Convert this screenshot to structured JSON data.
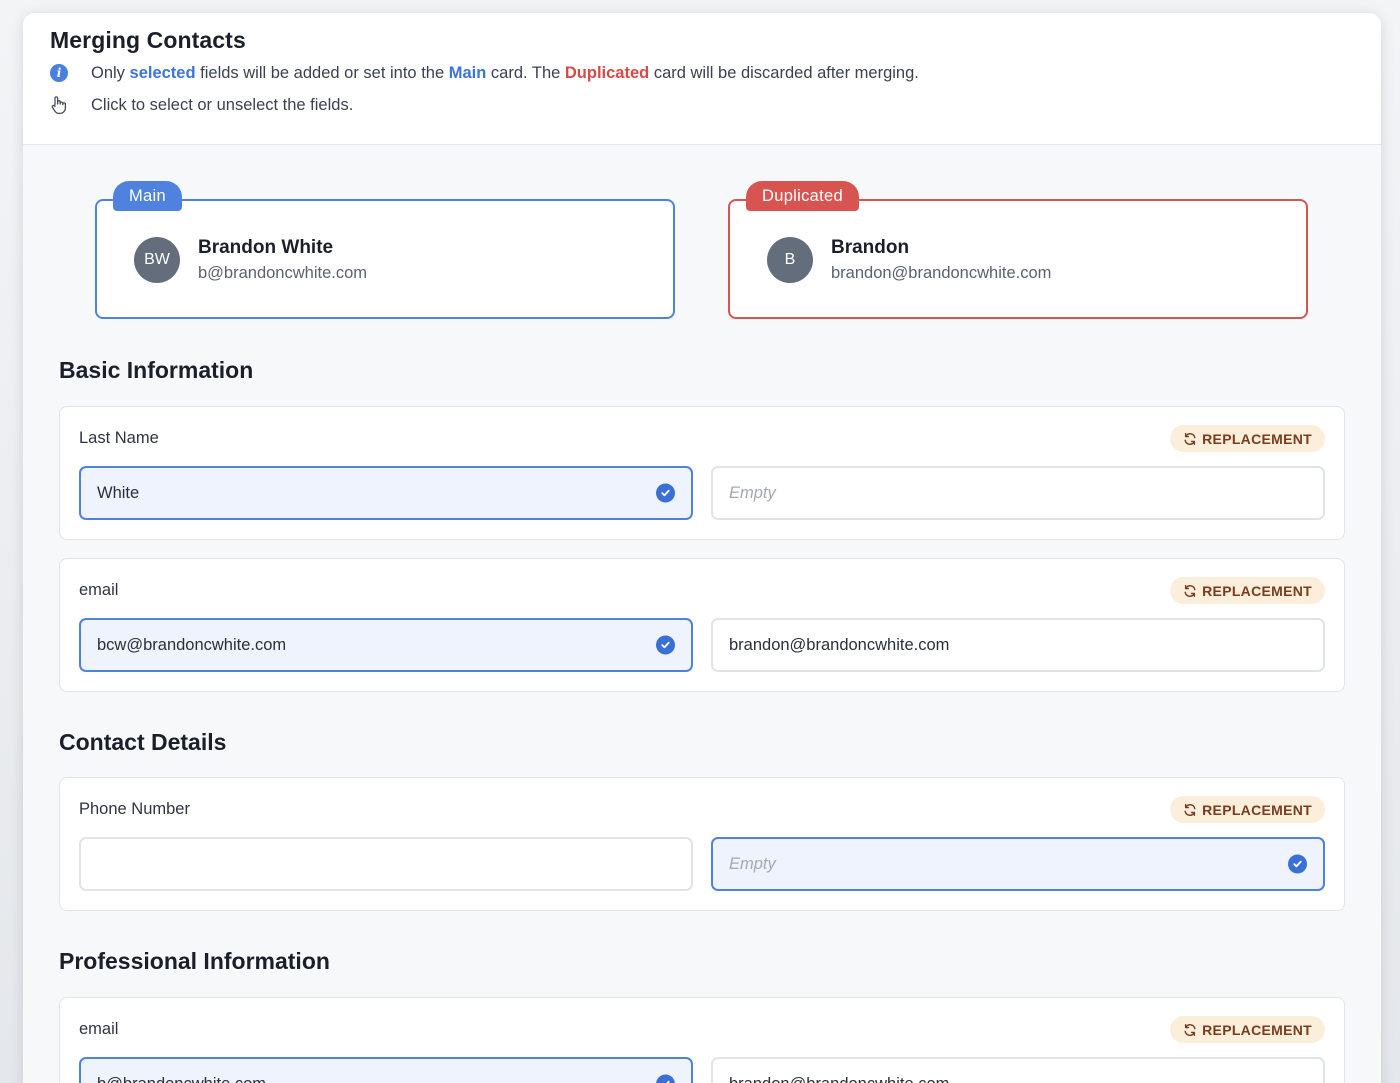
{
  "modal": {
    "title": "Merging Contacts",
    "hint1": {
      "prefix": "Only ",
      "selected_word": "selected",
      "middle": " fields will be added or set into the ",
      "main_word": "Main",
      "middle2": " card. The ",
      "duplicated_word": "Duplicated",
      "suffix": " card will be discarded after merging."
    },
    "hint2": "Click to select or unselect the fields."
  },
  "main_card": {
    "badge": "Main",
    "initials": "BW",
    "name": "Brandon White",
    "email": "b@brandoncwhite.com"
  },
  "dup_card": {
    "badge": "Duplicated",
    "initials": "B",
    "name": "Brandon",
    "email": "brandon@brandoncwhite.com"
  },
  "sections": {
    "basic": "Basic Information",
    "contact": "Contact Details",
    "professional": "Professional Information"
  },
  "fields": [
    {
      "label": "Last Name",
      "badge": "REPLACEMENT",
      "left": "White",
      "right": "Empty"
    },
    {
      "label": "email",
      "badge": "REPLACEMENT",
      "left": "bcw@brandoncwhite.com",
      "right": "brandon@brandoncwhite.com"
    },
    {
      "label": "Phone Number",
      "badge": "REPLACEMENT",
      "left": "",
      "right": "Empty"
    },
    {
      "label": "email",
      "badge": "REPLACEMENT",
      "left": "b@brandoncwhite.com",
      "right": "brandon@brandoncwhite.com"
    }
  ],
  "colors": {
    "main_accent": "#4f82df",
    "duplicated_accent": "#d85450",
    "replacement_bg": "#fbeedb",
    "replacement_text": "#7a3b1f"
  }
}
